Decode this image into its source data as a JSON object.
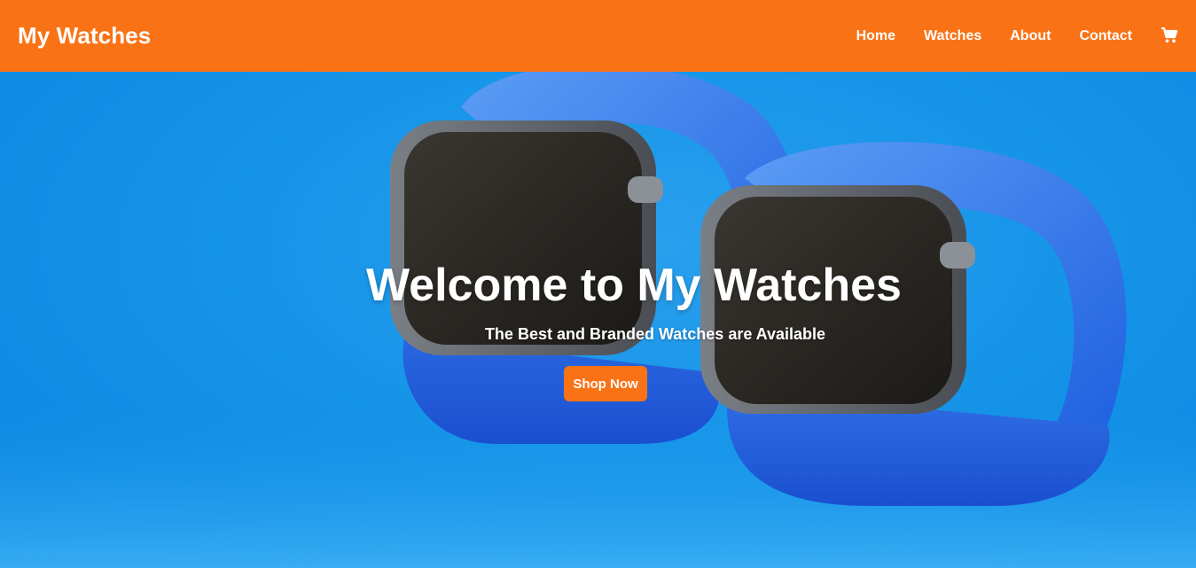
{
  "navbar": {
    "brand": "My Watches",
    "links": [
      {
        "label": "Home"
      },
      {
        "label": "Watches"
      },
      {
        "label": "About"
      },
      {
        "label": "Contact"
      }
    ],
    "cart_icon": "shopping-cart-icon"
  },
  "hero": {
    "title": "Welcome to My Watches",
    "subtitle": "The Best and Branded Watches are Available",
    "cta_label": "Shop Now",
    "image": "two-blue-smartwatches-photo"
  },
  "colors": {
    "accent": "#f97316",
    "hero_background": "#1594e8",
    "text": "#ffffff"
  }
}
